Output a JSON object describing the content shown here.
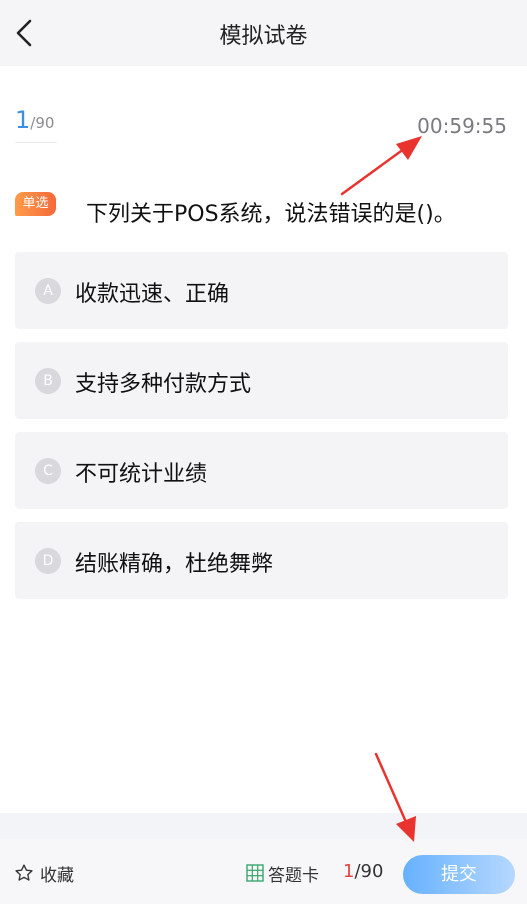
{
  "header": {
    "title": "模拟试卷",
    "back_icon": "chevron-left-icon"
  },
  "progress": {
    "current": "1",
    "total": "/90"
  },
  "timer": "00:59:55",
  "question": {
    "type_badge": "单选",
    "text": "下列关于POS系统，说法错误的是()。"
  },
  "options": [
    {
      "letter": "A",
      "text": "收款迅速、正确"
    },
    {
      "letter": "B",
      "text": "支持多种付款方式"
    },
    {
      "letter": "C",
      "text": "不可统计业绩"
    },
    {
      "letter": "D",
      "text": "结账精确，杜绝舞弊"
    }
  ],
  "footer": {
    "favorite_label": "收藏",
    "favorite_icon": "star-outline-icon",
    "answer_card_label": "答题卡",
    "answer_card_icon": "grid-icon",
    "count_current": "1",
    "count_total": "/90",
    "submit_label": "提交"
  },
  "colors": {
    "accent_blue": "#3a8ee6",
    "badge_orange": "#f46a3a",
    "annotation_red": "#e8332f",
    "count_red": "#e64340"
  }
}
